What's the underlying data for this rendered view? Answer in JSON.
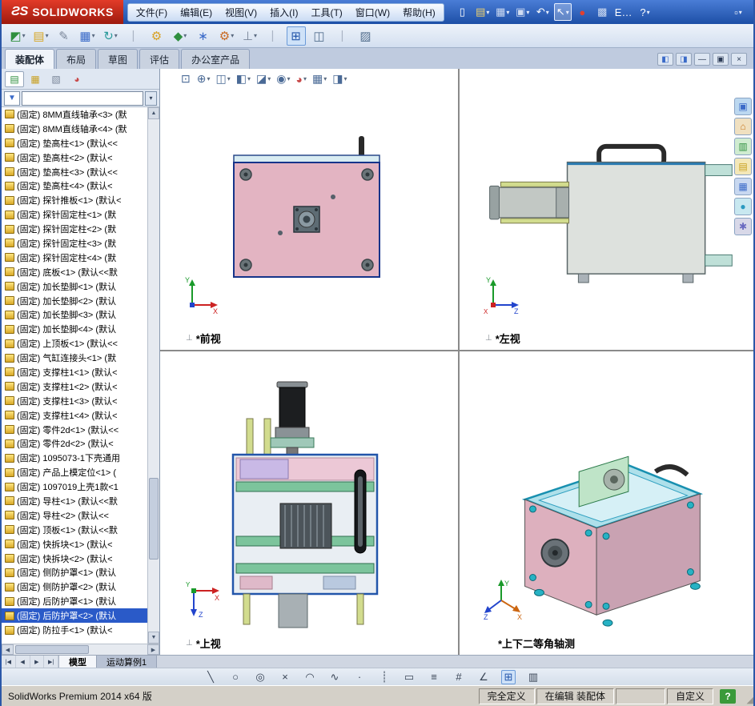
{
  "titlebar": {
    "logo_mark": "ƧS",
    "logo_text": "SOLIDWORKS",
    "menus": [
      "文件(F)",
      "编辑(E)",
      "视图(V)",
      "插入(I)",
      "工具(T)",
      "窗口(W)",
      "帮助(H)"
    ],
    "icons": [
      {
        "name": "new-document-icon",
        "glyph": "▯",
        "color": "#ffffff"
      },
      {
        "name": "open-icon",
        "glyph": "▤",
        "color": "#f2d36a",
        "caret": "▾"
      },
      {
        "name": "save-icon",
        "glyph": "▦",
        "color": "#cfdcf2",
        "caret": "▾"
      },
      {
        "name": "print-icon",
        "glyph": "▣",
        "color": "#cfdcf2",
        "caret": "▾"
      },
      {
        "name": "undo-icon",
        "glyph": "↶",
        "color": "#ffffff",
        "caret": "▾"
      },
      {
        "name": "select-icon",
        "glyph": "↖",
        "color": "#ffffff",
        "caret": "▾",
        "state": "pressed"
      },
      {
        "name": "rebuild-icon",
        "glyph": "●",
        "color": "#e04030"
      },
      {
        "name": "file-properties-icon",
        "glyph": "▩",
        "color": "#cfdcf2"
      },
      {
        "name": "epdm-icon",
        "glyph": "E…",
        "color": "#ffffff"
      },
      {
        "name": "help-icon",
        "glyph": "?",
        "color": "#ffffff",
        "caret": "▾"
      }
    ],
    "right_icons": [
      {
        "name": "toolbar-options-icon",
        "glyph": "▫",
        "color": "#ffffff",
        "caret": "▾"
      }
    ]
  },
  "toolbar": {
    "icons": [
      {
        "name": "insert-components-icon",
        "glyph": "◩",
        "color": "#2f8f3f",
        "caret": "▾"
      },
      {
        "name": "open-part-icon",
        "glyph": "▤",
        "color": "#d8a828",
        "caret": "▾"
      },
      {
        "name": "attachment-icon",
        "glyph": "✎",
        "color": "#7a8699"
      },
      {
        "name": "linear-pattern-icon",
        "glyph": "▦",
        "color": "#3a6ac8",
        "caret": "▾"
      },
      {
        "name": "rotate-component-icon",
        "glyph": "↻",
        "color": "#2a9a9a",
        "caret": "▾"
      },
      {
        "name": "separator-icon",
        "glyph": "|",
        "color": "#aab4c4"
      },
      {
        "name": "mate-icon",
        "glyph": "⚙",
        "color": "#d8a020"
      },
      {
        "name": "move-component-icon",
        "glyph": "◆",
        "color": "#2f8f3f",
        "caret": "▾"
      },
      {
        "name": "smart-fasteners-icon",
        "glyph": "∗",
        "color": "#3a6ac8"
      },
      {
        "name": "assembly-features-icon",
        "glyph": "⚙",
        "color": "#c86820",
        "caret": "▾"
      },
      {
        "name": "reference-geometry-icon",
        "glyph": "⊥",
        "color": "#7a8699",
        "caret": "▾"
      },
      {
        "name": "separator-icon",
        "glyph": "|",
        "color": "#aab4c4"
      },
      {
        "name": "viewport-layout-icon",
        "glyph": "⊞",
        "color": "#2255aa",
        "state": "pressed"
      },
      {
        "name": "section-view-icon",
        "glyph": "◫",
        "color": "#55708f"
      },
      {
        "name": "separator-icon",
        "glyph": "|",
        "color": "#aab4c4"
      },
      {
        "name": "display-settings-icon",
        "glyph": "▨",
        "color": "#55708f"
      }
    ]
  },
  "command_tabs": {
    "tabs": [
      {
        "label": "装配体",
        "state": "active"
      },
      {
        "label": "布局"
      },
      {
        "label": "草图"
      },
      {
        "label": "评估"
      },
      {
        "label": "办公室产品"
      }
    ]
  },
  "doc_controls": [
    {
      "name": "pane-left-icon",
      "glyph": "◧",
      "color": "#3a6ac8"
    },
    {
      "name": "pane-right-icon",
      "glyph": "◨",
      "color": "#3a6ac8"
    },
    {
      "name": "minimize-icon",
      "glyph": "—",
      "color": "#2a3a55"
    },
    {
      "name": "restore-icon",
      "glyph": "▣",
      "color": "#2a3a55"
    },
    {
      "name": "close-icon",
      "glyph": "×",
      "color": "#2a3a55"
    }
  ],
  "feature_tree": {
    "header_icons": [
      {
        "name": "featuremanager-tab-icon",
        "glyph": "▤",
        "color": "#2f8f3f",
        "state": "active"
      },
      {
        "name": "propertymanager-tab-icon",
        "glyph": "▦",
        "color": "#c8a020"
      },
      {
        "name": "configurations-tab-icon",
        "glyph": "▧",
        "color": "#7a8699"
      },
      {
        "name": "displaymanager-tab-icon",
        "glyph": "◕",
        "color": "#c84a4a"
      }
    ],
    "chevron": "»",
    "funnel_glyph": "▼",
    "drop_glyph": "▾",
    "scroll_up": "▲",
    "scroll_down": "▼",
    "scroll_left": "◀",
    "scroll_right": "▶",
    "items": [
      {
        "label": "(固定) 8MM直线轴承<3> (默"
      },
      {
        "label": "(固定) 8MM直线轴承<4> (默"
      },
      {
        "label": "(固定) 垫高柱<1> (默认<<"
      },
      {
        "label": "(固定) 垫高柱<2> (默认<"
      },
      {
        "label": "(固定) 垫高柱<3> (默认<<"
      },
      {
        "label": "(固定) 垫高柱<4> (默认<"
      },
      {
        "label": "(固定) 探针推板<1> (默认<"
      },
      {
        "label": "(固定) 探针固定柱<1> (默"
      },
      {
        "label": "(固定) 探针固定柱<2> (默"
      },
      {
        "label": "(固定) 探针固定柱<3> (默"
      },
      {
        "label": "(固定) 探针固定柱<4> (默"
      },
      {
        "label": "(固定) 底板<1> (默认<<默"
      },
      {
        "label": "(固定) 加长垫脚<1> (默认"
      },
      {
        "label": "(固定) 加长垫脚<2> (默认"
      },
      {
        "label": "(固定) 加长垫脚<3> (默认"
      },
      {
        "label": "(固定) 加长垫脚<4> (默认"
      },
      {
        "label": "(固定) 上顶板<1> (默认<<"
      },
      {
        "label": "(固定) 气缸连接头<1> (默"
      },
      {
        "label": "(固定) 支撑柱1<1> (默认<"
      },
      {
        "label": "(固定) 支撑柱1<2> (默认<"
      },
      {
        "label": "(固定) 支撑柱1<3> (默认<"
      },
      {
        "label": "(固定) 支撑柱1<4> (默认<"
      },
      {
        "label": "(固定) 零件2d<1> (默认<<"
      },
      {
        "label": "(固定) 零件2d<2> (默认<"
      },
      {
        "label": "(固定) 1095073-1下壳通用"
      },
      {
        "label": "(固定) 产品上模定位<1> ("
      },
      {
        "label": "(固定) 1097019上壳1款<1"
      },
      {
        "label": "(固定) 导柱<1> (默认<<默"
      },
      {
        "label": "(固定) 导柱<2> (默认<<"
      },
      {
        "label": "(固定) 顶板<1> (默认<<默"
      },
      {
        "label": "(固定) 快拆块<1> (默认<"
      },
      {
        "label": "(固定) 快拆块<2> (默认<"
      },
      {
        "label": "(固定) 侧防护罩<1> (默认"
      },
      {
        "label": "(固定) 侧防护罩<2> (默认"
      },
      {
        "label": "(固定) 后防护罩<1> (默认"
      },
      {
        "label": "(固定) 后防护罩<2> (默认",
        "state": "selected"
      },
      {
        "label": "(固定) 防拉手<1> (默认<"
      }
    ]
  },
  "viewport": {
    "origin_glyph": "⊥",
    "hud_icons": [
      {
        "name": "zoom-fit-icon",
        "glyph": "⊡",
        "color": "#4a6a96"
      },
      {
        "name": "zoom-area-icon",
        "glyph": "⊕",
        "color": "#4a6a96",
        "caret": "▾"
      },
      {
        "name": "section-view-icon",
        "glyph": "◫",
        "color": "#4a6a96",
        "caret": "▾"
      },
      {
        "name": "view-orientation-icon",
        "glyph": "◧",
        "color": "#4a6a96",
        "caret": "▾"
      },
      {
        "name": "display-style-icon",
        "glyph": "◪",
        "color": "#4a6a96",
        "caret": "▾"
      },
      {
        "name": "hide-show-items-icon",
        "glyph": "◉",
        "color": "#4a6a96",
        "caret": "▾"
      },
      {
        "name": "edit-appearance-icon",
        "glyph": "◕",
        "color": "#c84a4a",
        "caret": "▾"
      },
      {
        "name": "apply-scene-icon",
        "glyph": "▦",
        "color": "#4a6a96",
        "caret": "▾"
      },
      {
        "name": "view-settings-icon",
        "glyph": "◨",
        "color": "#4a6a96",
        "caret": "▾"
      }
    ],
    "views": [
      {
        "label": "*前视",
        "axis_up": "Y",
        "axis_right": "X"
      },
      {
        "label": "*左视",
        "axis_up": "Y",
        "axis_right": "Z",
        "axis_front": "X"
      },
      {
        "label": "*上视",
        "axis_right": "X",
        "axis_down": "Z",
        "axis_front": "Y"
      },
      {
        "label": "*上下二等角轴测",
        "axis_up": "Y",
        "axis_right": "X",
        "axis_left": "Z"
      }
    ]
  },
  "taskpane": {
    "icons": [
      {
        "name": "task-pane-home-icon",
        "glyph": "▣",
        "bg": "#bcd8f0",
        "color": "#3a6ac8"
      },
      {
        "name": "resources-home-icon",
        "glyph": "⌂",
        "bg": "#f0e0c0",
        "color": "#c87820"
      },
      {
        "name": "design-library-icon",
        "glyph": "▥",
        "bg": "#d0ecd0",
        "color": "#2f8f3f"
      },
      {
        "name": "file-explorer-icon",
        "glyph": "▤",
        "bg": "#f4e8b8",
        "color": "#c8a020"
      },
      {
        "name": "view-palette-icon",
        "glyph": "▦",
        "bg": "#c8d8f0",
        "color": "#3a6ac8"
      },
      {
        "name": "appearances-icon",
        "glyph": "●",
        "bg": "#c8e8f0",
        "color": "#2a9ac0"
      },
      {
        "name": "custom-properties-icon",
        "glyph": "✱",
        "bg": "#d8d8e8",
        "color": "#6a6ac0"
      }
    ]
  },
  "bottom": {
    "doc_nav": [
      "|◀",
      "◀",
      "▶",
      "▶|"
    ],
    "doc_tabs": [
      {
        "label": "模型",
        "state": "active"
      },
      {
        "label": "运动算例1"
      }
    ],
    "sketch_icons": [
      {
        "name": "line-icon",
        "glyph": "╲",
        "color": "#3a4556"
      },
      {
        "name": "circle-icon",
        "glyph": "○",
        "color": "#3a4556"
      },
      {
        "name": "ellipse-icon",
        "glyph": "◎",
        "color": "#3a4556"
      },
      {
        "name": "trim-icon",
        "glyph": "×",
        "color": "#3a4556"
      },
      {
        "name": "arc-icon",
        "glyph": "◠",
        "color": "#3a4556"
      },
      {
        "name": "spline-icon",
        "glyph": "∿",
        "color": "#3a4556"
      },
      {
        "name": "point-icon",
        "glyph": "·",
        "color": "#3a4556"
      },
      {
        "name": "centerline-icon",
        "glyph": "┊",
        "color": "#3a4556"
      },
      {
        "name": "rectangle-icon",
        "glyph": "▭",
        "color": "#3a4556"
      },
      {
        "name": "mirror-icon",
        "glyph": "≡",
        "color": "#3a4556"
      },
      {
        "name": "pattern-icon",
        "glyph": "#",
        "color": "#3a4556"
      },
      {
        "name": "smart-dimension-icon",
        "glyph": "∠",
        "color": "#3a4556"
      },
      {
        "name": "viewport-grid-icon",
        "glyph": "⊞",
        "color": "#2255aa",
        "state": "pressed"
      },
      {
        "name": "table-icon",
        "glyph": "▥",
        "color": "#3a4556"
      }
    ],
    "status": {
      "app": "SolidWorks Premium 2014 x64 版",
      "defined": "完全定义",
      "editing": "在编辑 装配体",
      "custom": "自定义",
      "help_glyph": "?",
      "grip_glyph": "◢"
    }
  }
}
